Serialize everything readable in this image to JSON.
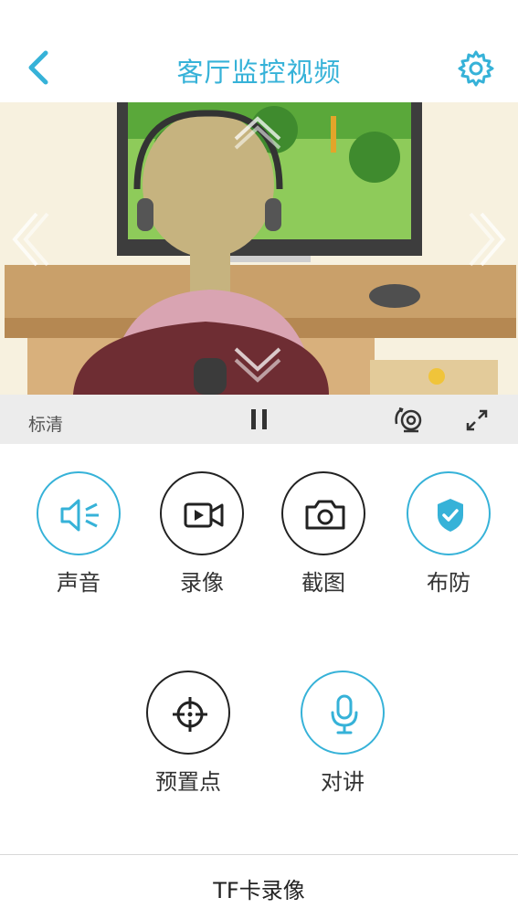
{
  "header": {
    "title": "客厅监控视频",
    "back_icon": "chevron-left-icon",
    "settings_icon": "gear-icon"
  },
  "video": {
    "quality_label": "标清",
    "pause_icon": "pause-icon",
    "camera_icon": "camera-switch-icon",
    "fullscreen_icon": "fullscreen-icon"
  },
  "controls": {
    "sound": "声音",
    "record": "录像",
    "screenshot": "截图",
    "arm": "布防",
    "preset": "预置点",
    "talk": "对讲"
  },
  "footer": {
    "tf_record": "TF卡录像"
  },
  "colors": {
    "accent": "#36b2d8",
    "text": "#333333"
  }
}
